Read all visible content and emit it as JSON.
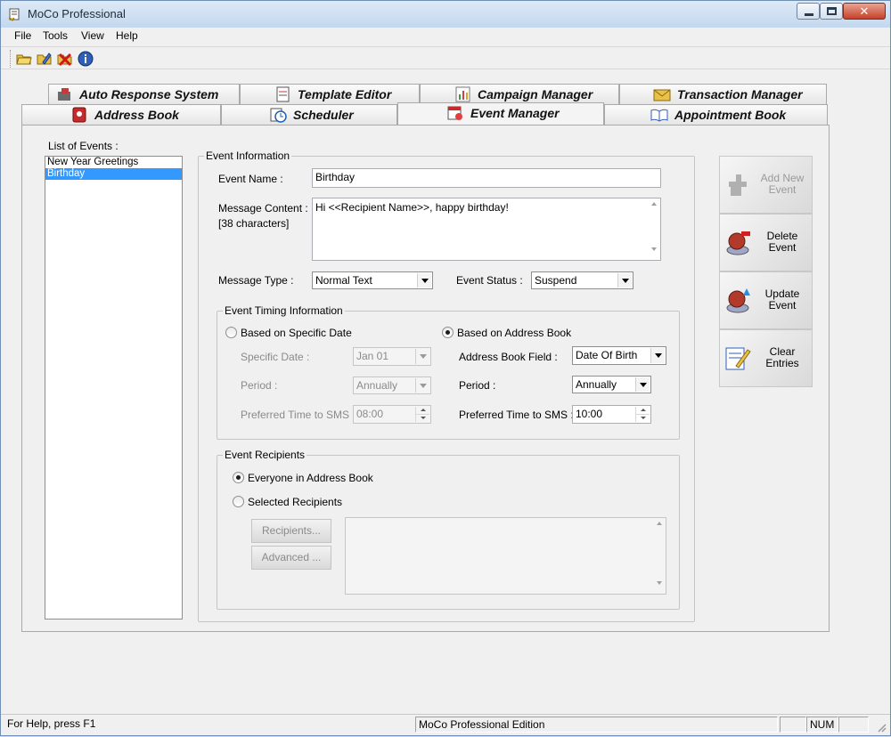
{
  "window": {
    "title": "MoCo Professional"
  },
  "menu": [
    "File",
    "Tools",
    "View",
    "Help"
  ],
  "toolbar": {
    "icons": [
      "open-folder-icon",
      "edit-icon",
      "delete-icon",
      "info-icon"
    ]
  },
  "tabs": {
    "row_back": [
      "Auto Response System",
      "Template Editor",
      "Campaign Manager",
      "Transaction Manager"
    ],
    "row_front": [
      "Address Book",
      "Scheduler",
      "Event Manager",
      "Appointment Book"
    ],
    "active": "Event Manager"
  },
  "events": {
    "label": "List of Events :",
    "items": [
      "New Year Greetings",
      "Birthday"
    ],
    "selected": "Birthday"
  },
  "event_info": {
    "group_title": "Event Information",
    "name_label": "Event Name :",
    "name_value": "Birthday",
    "content_label": "Message Content :",
    "char_count": "[38 characters]",
    "content_value": "Hi <<Recipient Name>>, happy birthday!",
    "type_label": "Message Type :",
    "type_value": "Normal Text",
    "status_label": "Event Status :",
    "status_value": "Suspend"
  },
  "timing": {
    "group_title": "Event Timing Information",
    "specific_date_radio": "Based on Specific Date",
    "address_book_radio": "Based on Address Book",
    "selected": "Based on Address Book",
    "specific_date_label": "Specific Date :",
    "specific_date_value": "Jan  01",
    "period_label_left": "Period :",
    "period_value_left": "Annually",
    "time_label_left": "Preferred Time to SMS :",
    "time_value_left": "08:00",
    "ab_field_label": "Address Book Field :",
    "ab_field_value": "Date Of Birth",
    "period_label_right": "Period :",
    "period_value_right": "Annually",
    "time_label_right": "Preferred Time to SMS :",
    "time_value_right": "10:00"
  },
  "recipients": {
    "group_title": "Event Recipients",
    "everyone_radio": "Everyone in Address Book",
    "selected_radio": "Selected Recipients",
    "selected": "Everyone in Address Book",
    "recipients_button": "Recipients...",
    "advanced_button": "Advanced ..."
  },
  "actions": {
    "add": "Add New\nEvent",
    "delete": "Delete\nEvent",
    "update": "Update\nEvent",
    "clear": "Clear\nEntries"
  },
  "status": {
    "help": "For Help, press F1",
    "edition": "MoCo Professional Edition",
    "num": "NUM"
  }
}
